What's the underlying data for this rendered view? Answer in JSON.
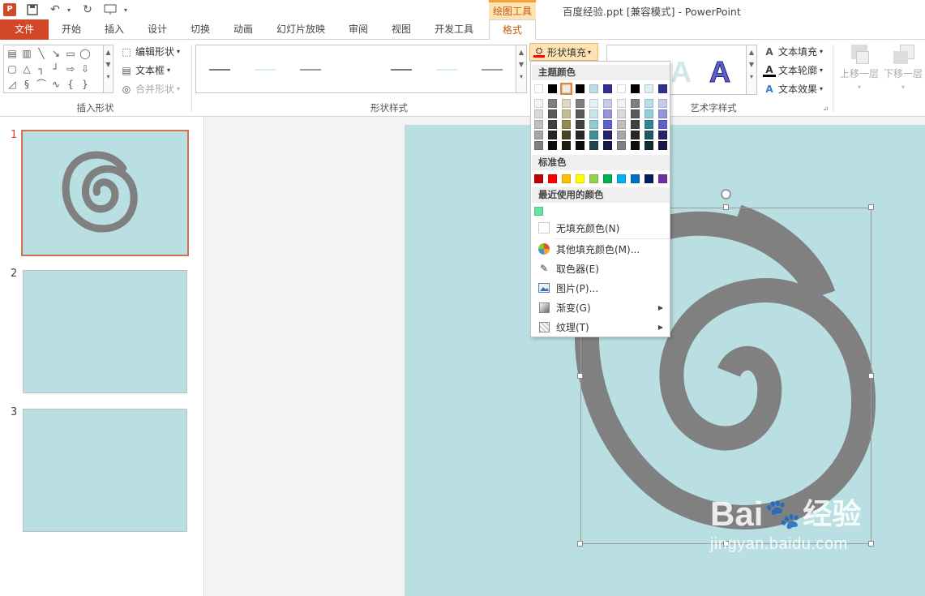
{
  "app": {
    "title": "百度经验.ppt [兼容模式] - PowerPoint",
    "context_tab": "绘图工具"
  },
  "tabs": [
    {
      "label": "文件"
    },
    {
      "label": "开始"
    },
    {
      "label": "插入"
    },
    {
      "label": "设计"
    },
    {
      "label": "切换"
    },
    {
      "label": "动画"
    },
    {
      "label": "幻灯片放映"
    },
    {
      "label": "审阅"
    },
    {
      "label": "视图"
    },
    {
      "label": "开发工具"
    },
    {
      "label": "格式"
    }
  ],
  "ribbon": {
    "insert_shapes": {
      "label": "插入形状",
      "edit_shape": "编辑形状",
      "text_box": "文本框",
      "merge_shapes": "合并形状"
    },
    "shape_styles": {
      "label": "形状样式",
      "shape_fill": "形状填充"
    },
    "wordart": {
      "label": "艺术字样式",
      "text_fill": "文本填充",
      "text_outline": "文本轮廓",
      "text_effects": "文本效果"
    },
    "arrange": {
      "bring_forward": "上移一层",
      "send_backward": "下移一层"
    }
  },
  "slides": [
    {
      "number": "1"
    },
    {
      "number": "2"
    },
    {
      "number": "3"
    }
  ],
  "fill_menu": {
    "theme_colors_label": "主题颜色",
    "standard_colors_label": "标准色",
    "recent_colors_label": "最近使用的颜色",
    "no_fill": "无填充颜色(N)",
    "more_colors": "其他填充颜色(M)...",
    "eyedropper": "取色器(E)",
    "picture": "图片(P)...",
    "gradient": "渐变(G)",
    "texture": "纹理(T)",
    "theme_top": [
      "#ffffff",
      "#000000",
      "#eeece1",
      "#000000",
      "#b9dfe2",
      "#2e3192",
      "#ffffff",
      "#000000",
      "#daeef3",
      "#2e3192"
    ],
    "theme_cols": [
      [
        "#f2f2f2",
        "#d9d9d9",
        "#bfbfbf",
        "#a6a6a6",
        "#808080"
      ],
      [
        "#7f7f7f",
        "#595959",
        "#404040",
        "#262626",
        "#0d0d0d"
      ],
      [
        "#ddd9c3",
        "#c4bd97",
        "#938953",
        "#494429",
        "#1d1b10"
      ],
      [
        "#7f7f7f",
        "#595959",
        "#404040",
        "#262626",
        "#0d0d0d"
      ],
      [
        "#e3f2f3",
        "#c7e5e8",
        "#8fcbd1",
        "#3f8f96",
        "#1f474b"
      ],
      [
        "#c9c9ef",
        "#9495df",
        "#5e60cf",
        "#22236d",
        "#161649"
      ],
      [
        "#f2f2f2",
        "#d9d9d9",
        "#bfbfbf",
        "#a6a6a6",
        "#808080"
      ],
      [
        "#7f7f7f",
        "#595959",
        "#404040",
        "#262626",
        "#0d0d0d"
      ],
      [
        "#b7dde8",
        "#92cddc",
        "#31859b",
        "#205867",
        "#0f2b33"
      ],
      [
        "#c9c9ef",
        "#9495df",
        "#5e60cf",
        "#22236d",
        "#161649"
      ]
    ],
    "standard": [
      "#c00000",
      "#ff0000",
      "#ffc000",
      "#ffff00",
      "#92d050",
      "#00b050",
      "#00b0f0",
      "#0070c0",
      "#002060",
      "#7030a0"
    ],
    "recent": [
      "#66e0a3"
    ]
  },
  "watermark": {
    "brand": "Bai",
    "brand2": "经验",
    "url": "jingyan.baidu.com"
  },
  "colors": {
    "accent": "#d24726",
    "context": "#c55a11",
    "slide_bg": "#b9dfe2",
    "shape": "#808080"
  }
}
